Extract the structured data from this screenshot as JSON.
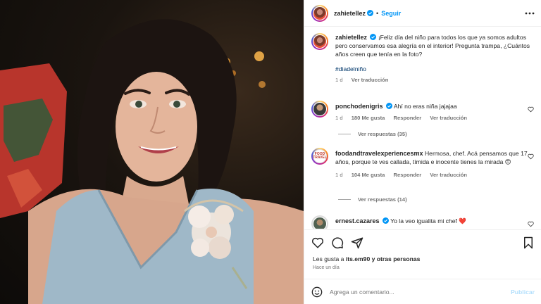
{
  "header": {
    "username": "zahietellez",
    "separator": "•",
    "follow_label": "Seguir"
  },
  "caption": {
    "username": "zahietellez",
    "text": "¡Feliz día del niño para todos los que ya somos adultos pero conservamos esa alegría en el interior! Pregunta trampa, ¿Cuántos años creen que tenía en la foto?",
    "hashtag": "#diadelniño",
    "time": "1 d",
    "translate_label": "Ver traducción"
  },
  "comments": [
    {
      "username": "ponchodenigris",
      "text": "Ahí no eras niña jajajaa",
      "time": "1 d",
      "likes": "180 Me gusta",
      "reply_label": "Responder",
      "translate_label": "Ver traducción",
      "replies_label": "Ver respuestas (35)"
    },
    {
      "username": "foodandtravelexperiencesmx",
      "text": "Hermosa, chef. Acá pensamos que 17 años, porque te ves callada, tímida e inocente tienes la mirada 😍",
      "time": "1 d",
      "likes": "104 Me gusta",
      "reply_label": "Responder",
      "translate_label": "Ver traducción",
      "replies_label": "Ver respuestas (14)",
      "avatar_text": "FOOD TRAVEL"
    },
    {
      "username": "ernest.cazares",
      "text": "Yo la veo igualita mi chef ❤️"
    }
  ],
  "likes_summary": {
    "prefix": "Les gusta a",
    "user": "its.em90",
    "suffix": "y otras personas"
  },
  "posted_ago": "Hace un día",
  "composer": {
    "placeholder": "Agrega un comentario...",
    "publish_label": "Publicar"
  },
  "colors": {
    "accent": "#0095f6",
    "verified": "#0095f6",
    "text": "#262626",
    "muted": "#737373",
    "dress": "#9fb8c8"
  },
  "icons": {
    "verified": "verified-badge-icon",
    "more": "more-options-icon",
    "like": "heart-icon",
    "comment": "comment-bubble-icon",
    "share": "paper-plane-icon",
    "save": "bookmark-icon",
    "emoji": "smiley-icon"
  }
}
